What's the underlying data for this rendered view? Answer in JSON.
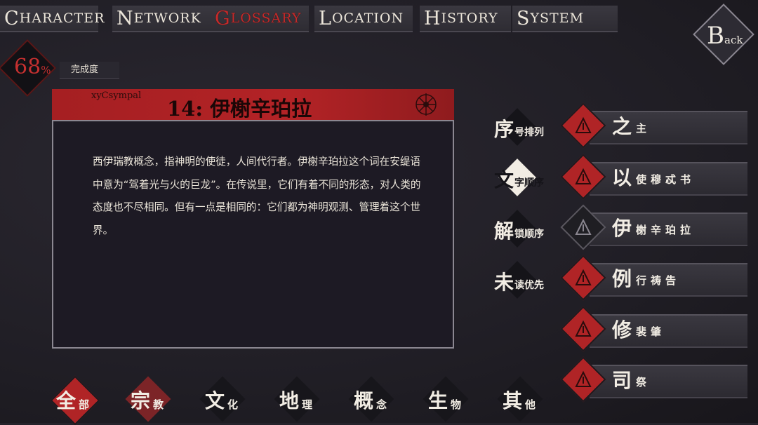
{
  "nav": {
    "tabs": [
      {
        "cap": "C",
        "rest": "HARACTER"
      },
      {
        "cap": "N",
        "rest": "ETWORK"
      },
      {
        "cap": "G",
        "rest": "LOSSARY"
      },
      {
        "cap": "L",
        "rest": "OCATION"
      },
      {
        "cap": "H",
        "rest": "ISTORY"
      },
      {
        "cap": "S",
        "rest": "YSTEM"
      }
    ],
    "back_big": "B",
    "back_small": "ack"
  },
  "completion": {
    "value": "68",
    "unit": "%",
    "label": "完成度"
  },
  "entry": {
    "subtitle": "xyCsympal",
    "title": "14:  伊榭辛珀拉",
    "body": "西伊瑞教概念，指神明的使徒，人间代行者。伊榭辛珀拉这个词在安缇语中意为“驾着光与火的巨龙”。在传说里，它们有着不同的形态，对人类的态度也不尽相同。但有一点是相同的：它们都为神明观测、管理着这个世界。"
  },
  "sort_options": [
    {
      "big": "序",
      "small": "号排列"
    },
    {
      "big": "文",
      "small": "字顺序"
    },
    {
      "big": "解",
      "small": "锁顺序"
    },
    {
      "big": "未",
      "small": "读优先"
    }
  ],
  "glossary_items": [
    {
      "big": "之",
      "small": "主"
    },
    {
      "big": "以",
      "small": "使穆忒书"
    },
    {
      "big": "伊",
      "small": "榭辛珀拉"
    },
    {
      "big": "例",
      "small": "行祷告"
    },
    {
      "big": "修",
      "small": "裴肇"
    },
    {
      "big": "司",
      "small": "祭"
    }
  ],
  "categories": [
    {
      "big": "全",
      "small": "部"
    },
    {
      "big": "宗",
      "small": "教"
    },
    {
      "big": "文",
      "small": "化"
    },
    {
      "big": "地",
      "small": "理"
    },
    {
      "big": "概",
      "small": "念"
    },
    {
      "big": "生",
      "small": "物"
    },
    {
      "big": "其",
      "small": "他"
    }
  ],
  "colors": {
    "accent_red": "#b02426",
    "background": "#25232b",
    "text": "#ece6da"
  }
}
